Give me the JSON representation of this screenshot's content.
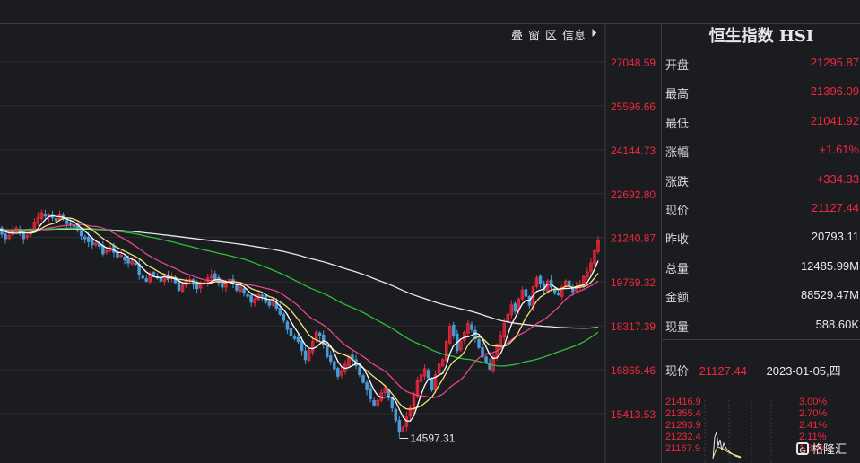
{
  "toolbar": {
    "items": [
      "叠",
      "窗",
      "区",
      "信息",
      "⏵"
    ]
  },
  "panel": {
    "title": "恒生指数 HSI",
    "rows": [
      {
        "label": "开盘",
        "value": "21295.87",
        "color": "red"
      },
      {
        "label": "最高",
        "value": "21396.09",
        "color": "red"
      },
      {
        "label": "最低",
        "value": "21041.92",
        "color": "red"
      },
      {
        "label": "涨幅",
        "value": "+1.61%",
        "color": "red"
      },
      {
        "label": "涨跌",
        "value": "+334.33",
        "color": "red"
      },
      {
        "label": "现价",
        "value": "21127.44",
        "color": "red"
      },
      {
        "label": "昨收",
        "value": "20793.11",
        "color": "white"
      },
      {
        "label": "总量",
        "value": "12485.99M",
        "color": "white"
      },
      {
        "label": "金额",
        "value": "88529.47M",
        "color": "white"
      },
      {
        "label": "现量",
        "value": "588.60K",
        "color": "white"
      }
    ],
    "current": {
      "label": "现价",
      "price": "21127.44",
      "datetime": "2023-01-05,四"
    },
    "mini_left": [
      "21416.9",
      "21355.4",
      "21293.9",
      "21232.4",
      "21167.9"
    ],
    "mini_right": [
      "3.00%",
      "2.70%",
      "2.41%",
      "2.11%",
      "1.80%"
    ],
    "logo": "格隆汇"
  },
  "chart_data": {
    "type": "candlestick",
    "title": "",
    "y_ticks": [
      "27048.59",
      "25596.66",
      "24144.73",
      "22692.80",
      "21240.87",
      "19769.32",
      "18317.39",
      "16865.46",
      "15413.53"
    ],
    "ylim": [
      14300,
      28000
    ],
    "low_annotation": "14597.31",
    "colors": {
      "up": "#f0283c",
      "down": "#4a9ad8",
      "ma5": "#ffffff",
      "ma10": "#f5e27a",
      "ma20": "#e8458c",
      "ma60": "#2fbf3c",
      "ma120": "#e8e8e8"
    },
    "closes": [
      21600,
      21350,
      21200,
      21300,
      21500,
      21550,
      21400,
      21200,
      21300,
      21500,
      21750,
      21900,
      22050,
      21950,
      22000,
      21900,
      21800,
      22000,
      21850,
      21700,
      21650,
      21600,
      21500,
      21300,
      21200,
      21100,
      21000,
      21050,
      20950,
      20700,
      20800,
      20900,
      20750,
      20600,
      20650,
      20500,
      20400,
      20450,
      20350,
      20000,
      19900,
      19800,
      20050,
      20000,
      19900,
      19800,
      20000,
      19850,
      19950,
      19750,
      19500,
      19650,
      19800,
      19850,
      19700,
      19550,
      19700,
      19750,
      19900,
      20000,
      19850,
      19750,
      19600,
      19750,
      19850,
      19700,
      19500,
      19600,
      19400,
      19300,
      19100,
      19200,
      19350,
      19300,
      19100,
      19000,
      19150,
      18900,
      18700,
      18500,
      18200,
      18000,
      17900,
      17800,
      17500,
      17200,
      17500,
      17800,
      18100,
      18000,
      17700,
      17300,
      17150,
      16900,
      16650,
      16800,
      17050,
      17300,
      17200,
      17000,
      16700,
      16450,
      16200,
      15900,
      15700,
      15850,
      16100,
      16250,
      15950,
      15600,
      15200,
      14800,
      14950,
      15300,
      15600,
      16050,
      16500,
      16700,
      16900,
      16600,
      16200,
      16700,
      17050,
      17200,
      17800,
      18300,
      18000,
      17500,
      17800,
      18100,
      18400,
      18200,
      17900,
      17600,
      17300,
      17100,
      16900,
      17300,
      17700,
      18000,
      18400,
      18700,
      19000,
      18800,
      19200,
      19500,
      19300,
      19000,
      19600,
      19900,
      19700,
      19500,
      19800,
      19600,
      19400,
      19350,
      19600,
      19800,
      19650,
      19450,
      19600,
      19700,
      19950,
      20100,
      20400,
      20800,
      21127
    ]
  }
}
